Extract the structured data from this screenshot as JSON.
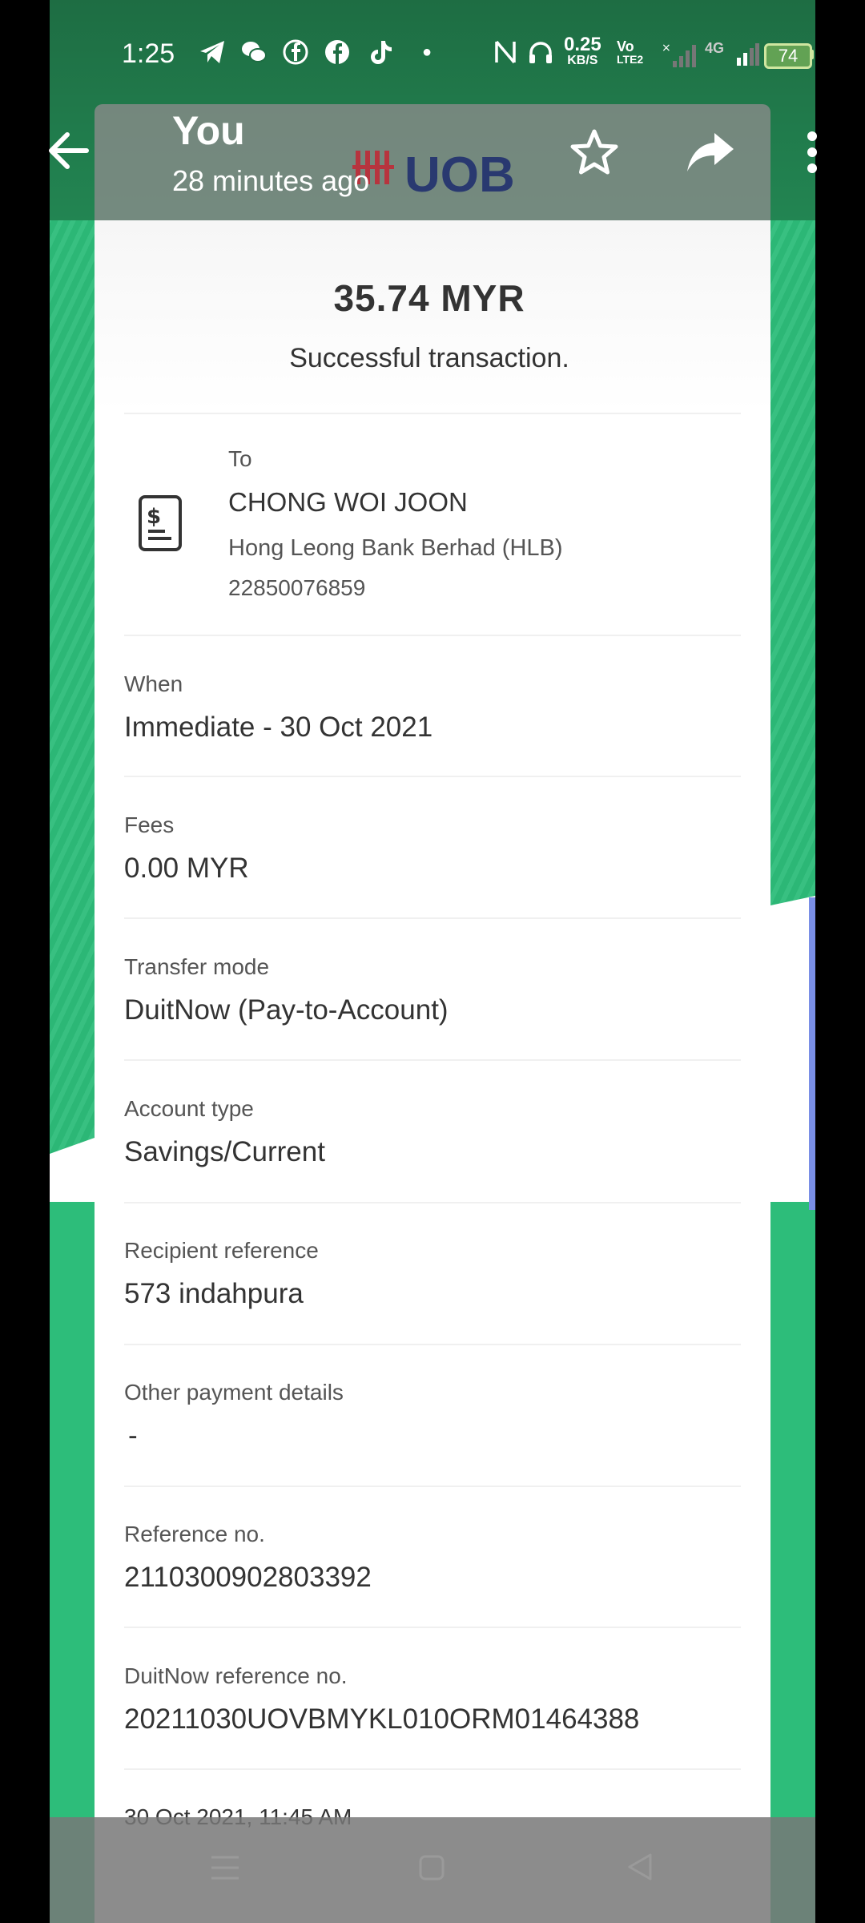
{
  "status_bar": {
    "time": "1:25",
    "net_speed_value": "0.25",
    "net_speed_unit": "KB/S",
    "volte": "Vo",
    "volte_sub": "LTE2",
    "network": "4G",
    "battery": "74"
  },
  "viewer": {
    "sender": "You",
    "time_ago": "28 minutes ago",
    "logo_text": "UOB"
  },
  "receipt": {
    "amount": "35.74  MYR",
    "status": "Successful transaction.",
    "to": {
      "label": "To",
      "name": "CHONG WOI JOON",
      "bank": "Hong Leong Bank Berhad (HLB)",
      "account": "22850076859"
    },
    "fields": [
      {
        "label": "When",
        "value": "Immediate - 30 Oct 2021"
      },
      {
        "label": "Fees",
        "value": "0.00 MYR"
      },
      {
        "label": "Transfer mode",
        "value": "DuitNow (Pay-to-Account)"
      },
      {
        "label": "Account type",
        "value": "Savings/Current"
      },
      {
        "label": "Recipient reference",
        "value": "573 indahpura"
      },
      {
        "label": "Other payment details",
        "value": "-"
      },
      {
        "label": "Reference no.",
        "value": "2110300902803392"
      },
      {
        "label": "DuitNow reference no.",
        "value": "20211030UOVBMYKL010ORM01464388"
      }
    ],
    "timestamp": "30 Oct 2021, 11:45 AM"
  }
}
